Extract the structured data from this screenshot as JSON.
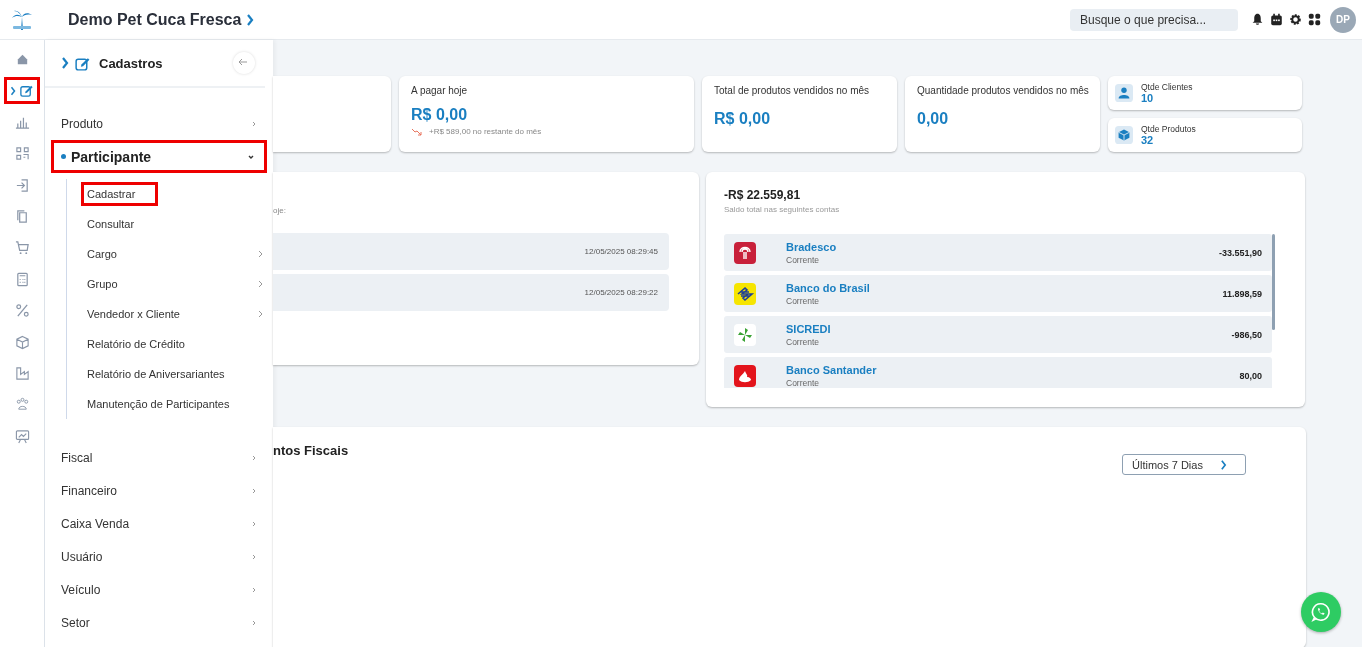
{
  "header": {
    "title": "Demo Pet Cuca Fresca",
    "search": {
      "placeholder": "Busque o que precisa..."
    },
    "avatar": "DP"
  },
  "rail": [
    {
      "selected": false,
      "highlighted": false
    },
    {
      "selected": true,
      "highlighted": true
    },
    {
      "selected": false,
      "highlighted": false
    },
    {
      "selected": false,
      "highlighted": false
    },
    {
      "selected": false,
      "highlighted": false
    },
    {
      "selected": false,
      "highlighted": false
    },
    {
      "selected": false,
      "highlighted": false
    },
    {
      "selected": false,
      "highlighted": false
    },
    {
      "selected": false,
      "highlighted": false
    },
    {
      "selected": false,
      "highlighted": false
    },
    {
      "selected": false,
      "highlighted": false
    },
    {
      "selected": false,
      "highlighted": false
    },
    {
      "selected": false,
      "highlighted": false
    }
  ],
  "menu": {
    "title": "Cadastros",
    "items": [
      {
        "label": "Produto",
        "expanded": false,
        "highlighted": false
      },
      {
        "label": "Participante",
        "expanded": true,
        "highlighted": true,
        "children": [
          {
            "label": "Cadastrar",
            "has_submenu": false,
            "highlighted": true
          },
          {
            "label": "Consultar",
            "has_submenu": false,
            "highlighted": false
          },
          {
            "label": "Cargo",
            "has_submenu": true,
            "highlighted": false
          },
          {
            "label": "Grupo",
            "has_submenu": true,
            "highlighted": false
          },
          {
            "label": "Vendedor x Cliente",
            "has_submenu": true,
            "highlighted": false
          },
          {
            "label": "Relatório de Crédito",
            "has_submenu": false,
            "highlighted": false
          },
          {
            "label": "Relatório de Aniversariantes",
            "has_submenu": false,
            "highlighted": false
          },
          {
            "label": "Manutenção de Participantes",
            "has_submenu": false,
            "highlighted": false
          }
        ]
      },
      {
        "label": "Fiscal",
        "expanded": false,
        "highlighted": false
      },
      {
        "label": "Financeiro",
        "expanded": false,
        "highlighted": false
      },
      {
        "label": "Caixa Venda",
        "expanded": false,
        "highlighted": false
      },
      {
        "label": "Usuário",
        "expanded": false,
        "highlighted": false
      },
      {
        "label": "Veículo",
        "expanded": false,
        "highlighted": false
      },
      {
        "label": "Setor",
        "expanded": false,
        "highlighted": false
      }
    ]
  },
  "stats": [
    {
      "label": "A pagar hoje",
      "value": "R$ 0,00",
      "note": "+R$ 589,00 no restante do mês"
    },
    {
      "label": "Total de produtos vendidos no mês",
      "value": "R$ 0,00"
    },
    {
      "label": "Quantidade produtos vendidos no mês",
      "value": "0,00"
    }
  ],
  "counters": [
    {
      "label": "Qtde Clientes",
      "value": "10"
    },
    {
      "label": "Qtde Produtos",
      "value": "32"
    }
  ],
  "activity": {
    "subtitle": "oje:",
    "rows": [
      {
        "time": "12/05/2025 08:29:45"
      },
      {
        "time": "12/05/2025 08:29:22"
      }
    ]
  },
  "accounts": {
    "total": "-R$ 22.559,81",
    "subtitle": "Saldo total nas seguintes contas",
    "items": [
      {
        "bank": "Bradesco",
        "type": "Corrente",
        "balance": "-33.551,90"
      },
      {
        "bank": "Banco do Brasil",
        "type": "Corrente",
        "balance": "11.898,59"
      },
      {
        "bank": "SICREDI",
        "type": "Corrente",
        "balance": "-986,50"
      },
      {
        "bank": "Banco Santander",
        "type": "Corrente",
        "balance": "80,00"
      }
    ]
  },
  "fiscal": {
    "title": "ntos Fiscais",
    "range": "Últimos 7 Dias"
  }
}
